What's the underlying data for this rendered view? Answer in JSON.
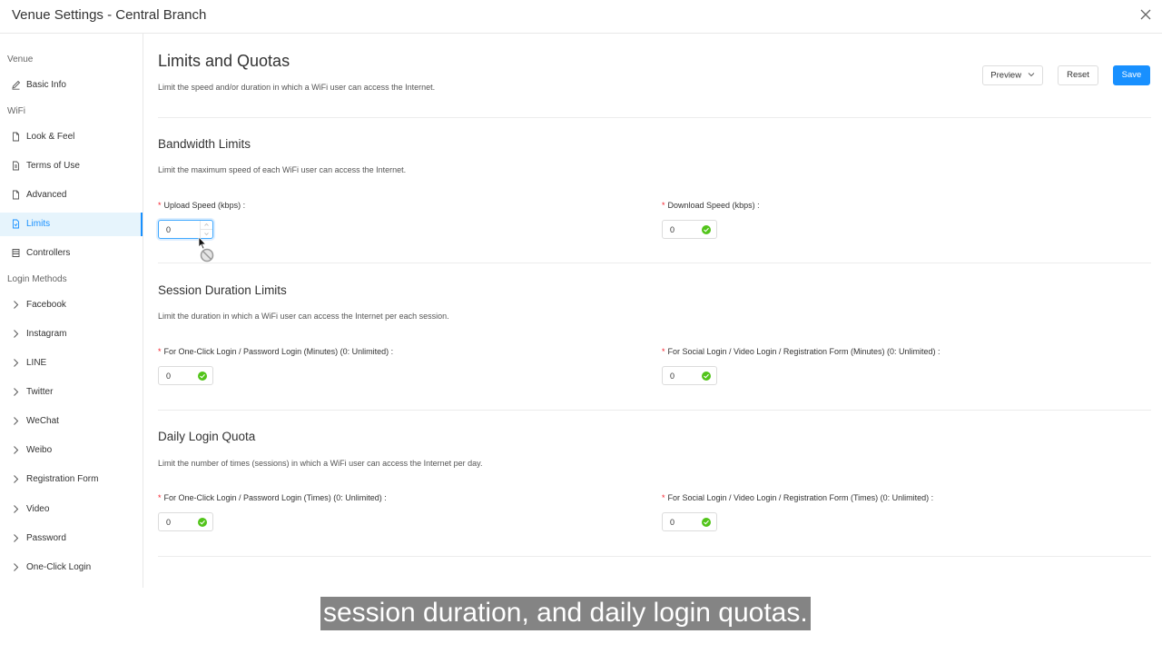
{
  "window": {
    "title": "Venue Settings - Central Branch"
  },
  "sidebar": {
    "groups": [
      {
        "label": "Venue"
      },
      {
        "label": "WiFi"
      },
      {
        "label": "Login Methods"
      }
    ],
    "items": [
      {
        "label": "Basic Info",
        "icon": "edit-icon"
      },
      {
        "label": "Look & Feel",
        "icon": "file-icon"
      },
      {
        "label": "Terms of Use",
        "icon": "file-text-icon"
      },
      {
        "label": "Advanced",
        "icon": "file-icon"
      },
      {
        "label": "Limits",
        "icon": "file-limit-icon",
        "active": true
      },
      {
        "label": "Controllers",
        "icon": "list-icon"
      },
      {
        "label": "Facebook",
        "icon": "chevron-right-icon"
      },
      {
        "label": "Instagram",
        "icon": "chevron-right-icon"
      },
      {
        "label": "LINE",
        "icon": "chevron-right-icon"
      },
      {
        "label": "Twitter",
        "icon": "chevron-right-icon"
      },
      {
        "label": "WeChat",
        "icon": "chevron-right-icon"
      },
      {
        "label": "Weibo",
        "icon": "chevron-right-icon"
      },
      {
        "label": "Registration Form",
        "icon": "chevron-right-icon"
      },
      {
        "label": "Video",
        "icon": "chevron-right-icon"
      },
      {
        "label": "Password",
        "icon": "chevron-right-icon"
      },
      {
        "label": "One-Click Login",
        "icon": "chevron-right-icon"
      }
    ]
  },
  "page": {
    "title": "Limits and Quotas",
    "description": "Limit the speed and/or duration in which a WiFi user can access the Internet."
  },
  "toolbar": {
    "preview_label": "Preview",
    "reset_label": "Reset",
    "save_label": "Save"
  },
  "sections": [
    {
      "title": "Bandwidth Limits",
      "description": "Limit the maximum speed of each WiFi user can access the Internet.",
      "fields": [
        {
          "label": "Upload Speed (kbps)",
          "value": "0",
          "state": "focused"
        },
        {
          "label": "Download Speed (kbps)",
          "value": "0",
          "state": "valid"
        }
      ]
    },
    {
      "title": "Session Duration Limits",
      "description": "Limit the duration in which a WiFi user can access the Internet per each session.",
      "fields": [
        {
          "label": "For One-Click Login / Password Login (Minutes) (0: Unlimited)",
          "value": "0",
          "state": "valid"
        },
        {
          "label": "For Social Login / Video Login / Registration Form (Minutes) (0: Unlimited)",
          "value": "0",
          "state": "valid"
        }
      ]
    },
    {
      "title": "Daily Login Quota",
      "description": "Limit the number of times (sessions) in which a WiFi user can access the Internet per day.",
      "fields": [
        {
          "label": "For One-Click Login / Password Login (Times) (0: Unlimited)",
          "value": "0",
          "state": "valid"
        },
        {
          "label": "For Social Login / Video Login / Registration Form (Times) (0: Unlimited)",
          "value": "0",
          "state": "valid"
        }
      ]
    }
  ],
  "caption": "session duration, and daily login quotas.",
  "colors": {
    "accent": "#1890ff",
    "valid": "#52c41a",
    "required": "#f5222d"
  }
}
